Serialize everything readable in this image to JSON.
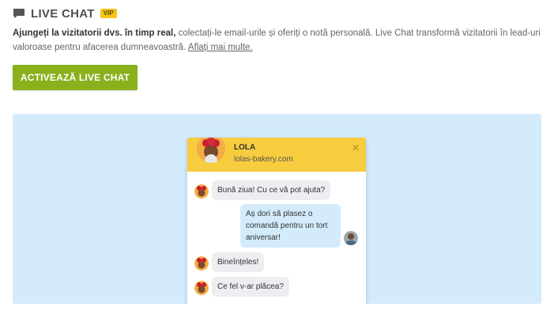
{
  "header": {
    "title": "LIVE CHAT",
    "badge": "VIP",
    "icon": "chat-bubble-icon"
  },
  "description": {
    "bold": "Ajungeți la vizitatorii dvs. în timp real,",
    "text": " colectați-le email-urile și oferiți o notă personală. Live Chat transformă vizitatorii în lead-uri valoroase pentru afacerea dumneavoastră.",
    "link": "Aflați mai multe."
  },
  "cta": {
    "label": "ACTIVEAZĂ LIVE CHAT",
    "color": "#8ab01c"
  },
  "preview": {
    "background": "#d3ebfb",
    "widget": {
      "agent_name": "LOLA",
      "site": "lolas-bakery.com",
      "close_icon": "close-icon",
      "header_color": "#f8cc3f",
      "messages": [
        {
          "from": "agent",
          "text": "Bună ziua! Cu ce vă pot ajuta?"
        },
        {
          "from": "visitor",
          "text": "Aș dori să plasez o comandă pentru un tort aniversar!"
        },
        {
          "from": "agent",
          "text": "Bineînțeles!"
        },
        {
          "from": "agent",
          "text": "Ce fel v-ar plăcea?"
        }
      ]
    }
  }
}
